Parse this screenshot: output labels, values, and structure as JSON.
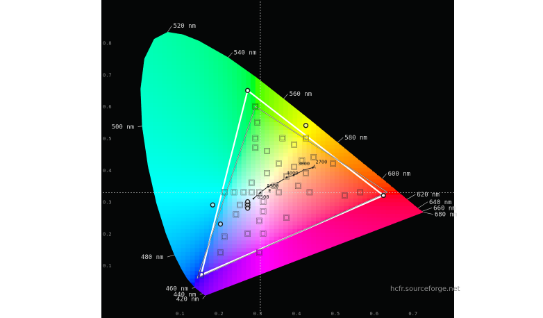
{
  "chart_data": {
    "type": "scatter",
    "title": "",
    "xlabel": "",
    "ylabel": "",
    "xlim": [
      0.1,
      0.72
    ],
    "ylim": [
      0.0,
      0.85
    ],
    "x_ticks": [
      "0.1",
      "0.2",
      "0.3",
      "0.4",
      "0.5",
      "0.6",
      "0.7"
    ],
    "y_ticks": [
      "0.1",
      "0.2",
      "0.3",
      "0.4",
      "0.5",
      "0.6",
      "0.7",
      "0.8"
    ],
    "grid": "dotted crosshair at white point",
    "white_point": {
      "x": 0.3127,
      "y": 0.329
    },
    "spectral_locus": [
      {
        "nm": 420,
        "x": 0.171,
        "y": 0.005
      },
      {
        "nm": 440,
        "x": 0.164,
        "y": 0.011
      },
      {
        "nm": 460,
        "x": 0.144,
        "y": 0.03
      },
      {
        "nm": 470,
        "x": 0.124,
        "y": 0.058
      },
      {
        "nm": 475,
        "x": 0.11,
        "y": 0.087
      },
      {
        "nm": 480,
        "x": 0.091,
        "y": 0.133
      },
      {
        "nm": 485,
        "x": 0.069,
        "y": 0.201
      },
      {
        "nm": 490,
        "x": 0.045,
        "y": 0.295
      },
      {
        "nm": 495,
        "x": 0.023,
        "y": 0.413
      },
      {
        "nm": 500,
        "x": 0.008,
        "y": 0.538
      },
      {
        "nm": 505,
        "x": 0.004,
        "y": 0.655
      },
      {
        "nm": 510,
        "x": 0.014,
        "y": 0.75
      },
      {
        "nm": 515,
        "x": 0.039,
        "y": 0.812
      },
      {
        "nm": 520,
        "x": 0.074,
        "y": 0.834
      },
      {
        "nm": 525,
        "x": 0.114,
        "y": 0.826
      },
      {
        "nm": 530,
        "x": 0.155,
        "y": 0.806
      },
      {
        "nm": 540,
        "x": 0.23,
        "y": 0.754
      },
      {
        "nm": 550,
        "x": 0.302,
        "y": 0.692
      },
      {
        "nm": 560,
        "x": 0.373,
        "y": 0.624
      },
      {
        "nm": 570,
        "x": 0.444,
        "y": 0.555
      },
      {
        "nm": 580,
        "x": 0.512,
        "y": 0.487
      },
      {
        "nm": 590,
        "x": 0.575,
        "y": 0.424
      },
      {
        "nm": 600,
        "x": 0.627,
        "y": 0.373
      },
      {
        "nm": 620,
        "x": 0.691,
        "y": 0.308
      },
      {
        "nm": 640,
        "x": 0.719,
        "y": 0.28
      },
      {
        "nm": 660,
        "x": 0.73,
        "y": 0.27
      },
      {
        "nm": 680,
        "x": 0.733,
        "y": 0.267
      }
    ],
    "wavelength_labels": [
      {
        "nm": 420,
        "text": "420 nm"
      },
      {
        "nm": 440,
        "text": "440 nm"
      },
      {
        "nm": 460,
        "text": "460 nm"
      },
      {
        "nm": 480,
        "text": "480 nm"
      },
      {
        "nm": 500,
        "text": "500 nm"
      },
      {
        "nm": 520,
        "text": "520 nm"
      },
      {
        "nm": 540,
        "text": "540 nm"
      },
      {
        "nm": 560,
        "text": "560 nm"
      },
      {
        "nm": 580,
        "text": "580 nm"
      },
      {
        "nm": 600,
        "text": "600 nm"
      },
      {
        "nm": 620,
        "text": "620 nm"
      },
      {
        "nm": 640,
        "text": "640 nm"
      },
      {
        "nm": 660,
        "text": "660 nm"
      },
      {
        "nm": 680,
        "text": "680 nm"
      }
    ],
    "gamut_reference": [
      [
        0.64,
        0.33
      ],
      [
        0.3,
        0.6
      ],
      [
        0.15,
        0.06
      ]
    ],
    "gamut_measured": [
      [
        0.63,
        0.32
      ],
      [
        0.28,
        0.65
      ],
      [
        0.16,
        0.07
      ]
    ],
    "blackbody_curve": [
      [
        0.4476,
        0.4074
      ],
      [
        0.4244,
        0.3994
      ],
      [
        0.3985,
        0.3833
      ],
      [
        0.3805,
        0.3768
      ],
      [
        0.3566,
        0.3588
      ],
      [
        0.3324,
        0.3474
      ],
      [
        0.3127,
        0.329
      ],
      [
        0.295,
        0.31
      ]
    ],
    "kelvin_labels": [
      {
        "x": 0.41,
        "y": 0.415,
        "text": "3000"
      },
      {
        "x": 0.455,
        "y": 0.42,
        "text": "2700"
      },
      {
        "x": 0.38,
        "y": 0.385,
        "text": "4000"
      },
      {
        "x": 0.33,
        "y": 0.345,
        "text": "5500"
      },
      {
        "x": 0.305,
        "y": 0.31,
        "text": "6500"
      }
    ],
    "illuminant_labels": [
      {
        "x": 0.448,
        "y": 0.405,
        "text": "A"
      },
      {
        "x": 0.333,
        "y": 0.33,
        "text": "E"
      }
    ],
    "reference_squares": [
      [
        0.3,
        0.6
      ],
      [
        0.305,
        0.55
      ],
      [
        0.3,
        0.5
      ],
      [
        0.3,
        0.47
      ],
      [
        0.33,
        0.46
      ],
      [
        0.37,
        0.5
      ],
      [
        0.4,
        0.48
      ],
      [
        0.43,
        0.5
      ],
      [
        0.45,
        0.44
      ],
      [
        0.5,
        0.42
      ],
      [
        0.36,
        0.42
      ],
      [
        0.4,
        0.41
      ],
      [
        0.42,
        0.43
      ],
      [
        0.33,
        0.39
      ],
      [
        0.38,
        0.38
      ],
      [
        0.43,
        0.39
      ],
      [
        0.29,
        0.36
      ],
      [
        0.35,
        0.35
      ],
      [
        0.41,
        0.35
      ],
      [
        0.36,
        0.33
      ],
      [
        0.44,
        0.33
      ],
      [
        0.53,
        0.32
      ],
      [
        0.57,
        0.33
      ],
      [
        0.22,
        0.33
      ],
      [
        0.245,
        0.33
      ],
      [
        0.27,
        0.33
      ],
      [
        0.29,
        0.33
      ],
      [
        0.31,
        0.33
      ],
      [
        0.25,
        0.26
      ],
      [
        0.26,
        0.29
      ],
      [
        0.28,
        0.29
      ],
      [
        0.32,
        0.3
      ],
      [
        0.28,
        0.2
      ],
      [
        0.31,
        0.24
      ],
      [
        0.32,
        0.27
      ],
      [
        0.38,
        0.25
      ],
      [
        0.22,
        0.19
      ],
      [
        0.31,
        0.14
      ],
      [
        0.32,
        0.2
      ],
      [
        0.21,
        0.14
      ],
      [
        0.16,
        0.07
      ]
    ],
    "measured_circles": [
      [
        0.28,
        0.65
      ],
      [
        0.43,
        0.54
      ],
      [
        0.63,
        0.32
      ],
      [
        0.19,
        0.29
      ],
      [
        0.21,
        0.23
      ],
      [
        0.28,
        0.29
      ],
      [
        0.28,
        0.3
      ],
      [
        0.28,
        0.28
      ]
    ]
  },
  "watermark": "hcfr.sourceforge.net"
}
